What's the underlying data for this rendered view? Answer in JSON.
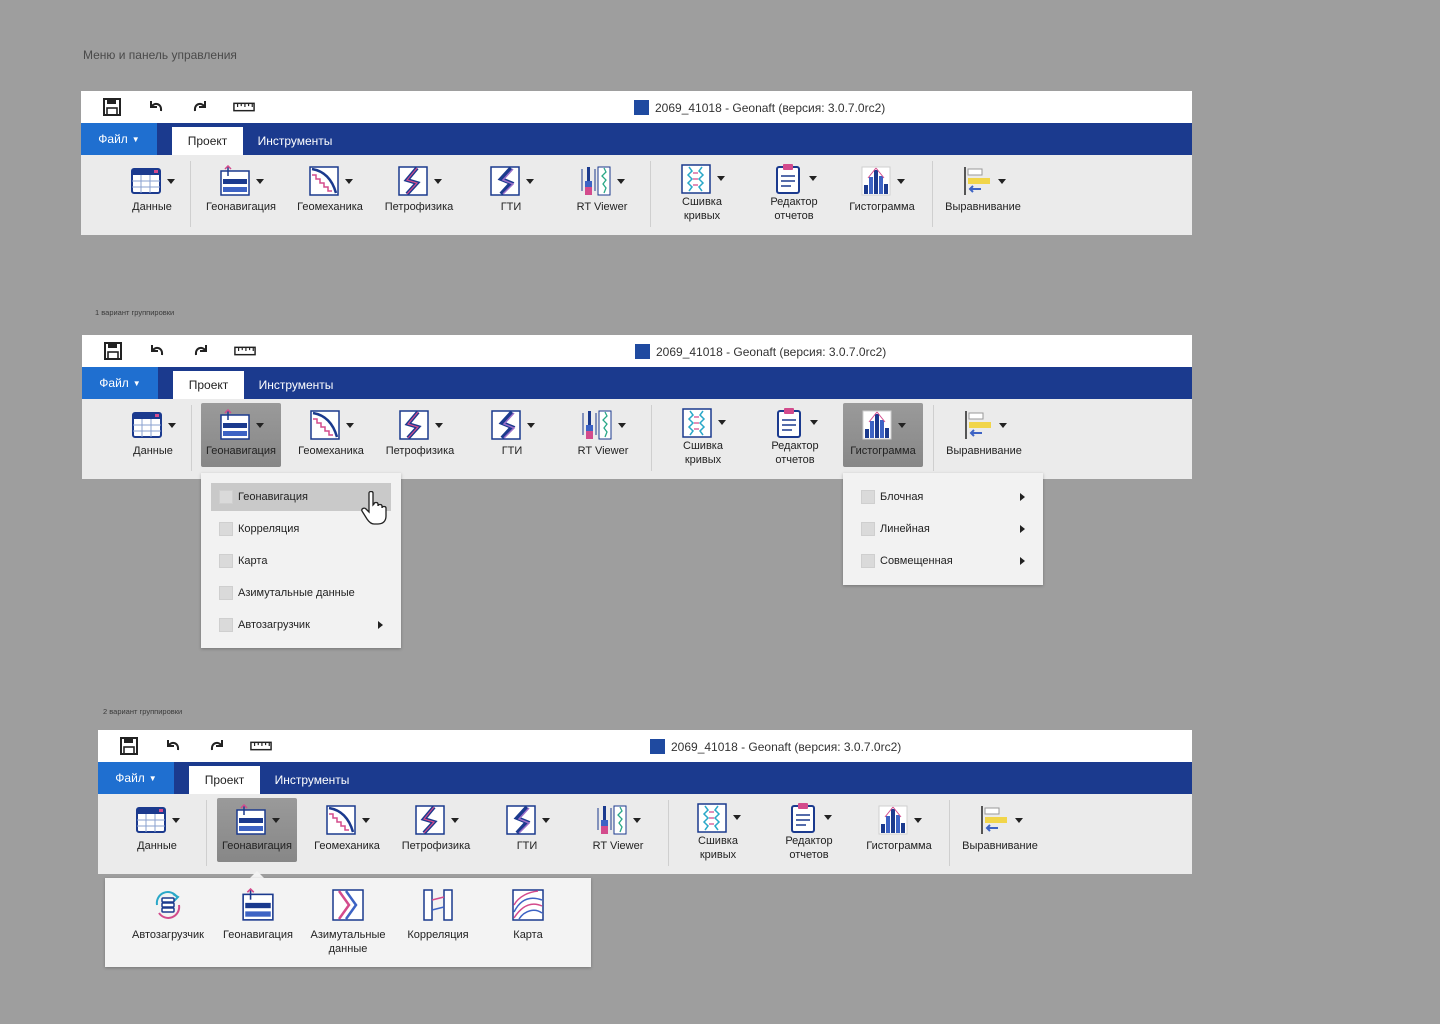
{
  "captions": {
    "main": "Меню и панель управления",
    "variant1": "1 вариант группировки",
    "variant2": "2 вариант группировки"
  },
  "window": {
    "title": "2069_41018  - Geonaft (версия: 3.0.7.0rc2)",
    "quick_access": [
      "save-icon",
      "undo-icon",
      "redo-icon",
      "ruler-icon"
    ]
  },
  "tabs": {
    "file": "Файл",
    "project": "Проект",
    "tools": "Инструменты"
  },
  "ribbon": {
    "data": "Данные",
    "geonav": "Геонавигация",
    "geomech": "Геомеханика",
    "petro": "Петрофизика",
    "gti": "ГТИ",
    "rtviewer": "RT Viewer",
    "stitch_1": "Сшивка",
    "stitch_2": "кривых",
    "reports_1": "Редактор",
    "reports_2": "отчетов",
    "histogram": "Гистограмма",
    "align": "Выравнивание"
  },
  "geonav_menu": [
    {
      "label": "Геонавигация",
      "submenu": false
    },
    {
      "label": "Корреляция",
      "submenu": false
    },
    {
      "label": "Карта",
      "submenu": false
    },
    {
      "label": "Азимутальные данные",
      "submenu": false
    },
    {
      "label": "Автозагрузчик",
      "submenu": true
    }
  ],
  "histogram_menu": [
    {
      "label": "Блочная",
      "submenu": true
    },
    {
      "label": "Линейная",
      "submenu": true
    },
    {
      "label": "Совмещенная",
      "submenu": true
    }
  ],
  "geonav_gallery": [
    {
      "label": "Автозагрузчик",
      "icon": "autoloader-icon"
    },
    {
      "label": "Геонавигация",
      "icon": "geonavigation-icon"
    },
    {
      "label": "Азимутальные данные",
      "icon": "azimuthal-data-icon"
    },
    {
      "label": "Корреляция",
      "icon": "correlation-icon"
    },
    {
      "label": "Карта",
      "icon": "map-icon"
    }
  ],
  "colors": {
    "ribbon_tabs_bg": "#1b3a8e",
    "file_button_bg": "#1f6fd0",
    "ribbon_body_bg": "#ebebeb",
    "canvas_bg": "#9e9e9e"
  }
}
